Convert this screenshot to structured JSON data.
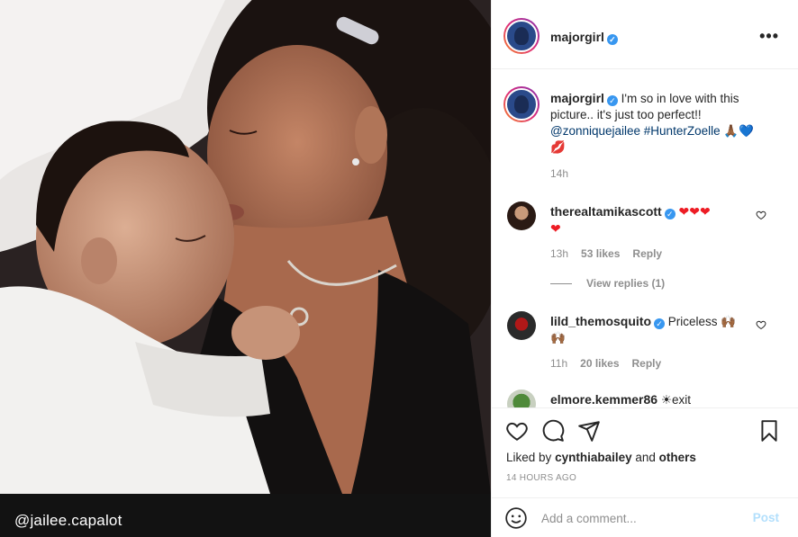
{
  "photo": {
    "watermark": "@jailee.capalot"
  },
  "header": {
    "username": "majorgirl",
    "more_icon": "more-horizontal-icon"
  },
  "caption": {
    "username": "majorgirl",
    "text": "I'm so in love with this picture.. it's just too perfect!!",
    "mention": "@zonniquejailee",
    "hashtag": "#HunterZoelle",
    "emojis": "🙏🏾💙",
    "emoji_line2": "💋",
    "time": "14h"
  },
  "comments": [
    {
      "username": "therealtamikascott",
      "text": "❤❤❤",
      "text2": "❤",
      "time": "13h",
      "likes": "53 likes",
      "reply": "Reply",
      "view_replies": "View replies (1)"
    },
    {
      "username": "lild_themosquito",
      "text": "Priceless 🙌🏾",
      "text2": "🙌🏾",
      "time": "11h",
      "likes": "20 likes",
      "reply": "Reply"
    },
    {
      "username": "elmore.kemmer86",
      "text": "☀exit"
    }
  ],
  "actions": {
    "liked_by_prefix": "Liked by",
    "liked_by_user": "cynthiabailey",
    "and": "and",
    "others": "others",
    "post_time": "14 HOURS AGO"
  },
  "add_comment": {
    "placeholder": "Add a comment...",
    "post_label": "Post"
  },
  "colors": {
    "link": "#00376b",
    "verified": "#3897f0",
    "post_disabled": "#b2dffc"
  }
}
